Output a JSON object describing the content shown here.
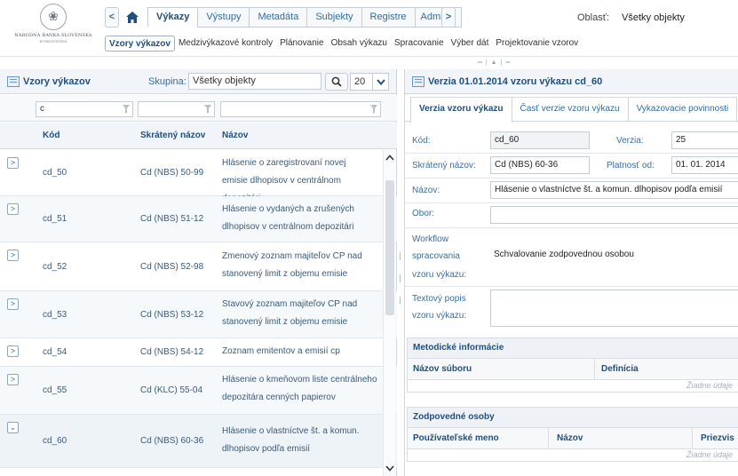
{
  "logo": {
    "line1": "NÁRODNÁ BANKA SLOVENSKA",
    "line2": "EUROSYSTÉM"
  },
  "header": {
    "tabs": [
      {
        "label": "Výkazy",
        "active": true
      },
      {
        "label": "Výstupy",
        "active": false
      },
      {
        "label": "Metadáta",
        "active": false
      },
      {
        "label": "Subjekty",
        "active": false
      },
      {
        "label": "Registre",
        "active": false
      },
      {
        "label": "Adminis",
        "active": false
      }
    ],
    "area_label": "Oblasť:",
    "area_value": "Všetky objekty"
  },
  "subnav": [
    {
      "label": "Vzory výkazov",
      "active": true
    },
    {
      "label": "Medzivýkazové kontroly",
      "active": false
    },
    {
      "label": "Plánovanie",
      "active": false
    },
    {
      "label": "Obsah výkazu",
      "active": false
    },
    {
      "label": "Spracovanie",
      "active": false
    },
    {
      "label": "Výber dát",
      "active": false
    },
    {
      "label": "Projektovanie vzorov",
      "active": false
    }
  ],
  "left": {
    "title": "Vzory výkazov",
    "group_label": "Skupina:",
    "group_value": "Všetky objekty",
    "page_size": "20",
    "filters": [
      "c",
      "",
      ""
    ],
    "columns": [
      "Kód",
      "Skrátený názov",
      "Názov"
    ],
    "rows": [
      {
        "code": "cd_50",
        "short": "Cd (NBS) 50-99",
        "name": "Hlásenie o zaregistrovaní novej emisie dlhopisov v centrálnom depozitári",
        "expanded": false
      },
      {
        "code": "cd_51",
        "short": "Cd (NBS) 51-12",
        "name": "Hlásenie o vydaných a zrušených dlhopisov v centrálnom depozitári",
        "expanded": false
      },
      {
        "code": "cd_52",
        "short": "Cd (NBS) 52-98",
        "name": "Zmenový zoznam majiteľov CP nad stanovený limit z objemu emisie",
        "expanded": false
      },
      {
        "code": "cd_53",
        "short": "Cd (NBS) 53-12",
        "name": "Stavový zoznam majiteľov CP nad stanovený limit z objemu emisie",
        "expanded": false
      },
      {
        "code": "cd_54",
        "short": "Cd (NBS) 54-12",
        "name": "Zoznam emitentov a emisií cp",
        "expanded": false
      },
      {
        "code": "cd_55",
        "short": "Cd (KLC) 55-04",
        "name": "Hlásenie o kmeňovom liste centrálneho depozitára cenných papierov",
        "expanded": false
      },
      {
        "code": "cd_60",
        "short": "Cd (NBS) 60-36",
        "name": "Hlásenie o vlastníctve št. a komun. dlhopisov podľa emisií",
        "expanded": true
      }
    ]
  },
  "right": {
    "title": "Verzia 01.01.2014 vzoru výkazu cd_60",
    "tabs": [
      {
        "label": "Verzia vzoru výkazu",
        "active": true
      },
      {
        "label": "Časť verzie vzoru výkazu",
        "active": false
      },
      {
        "label": "Vykazovacie povinnosti",
        "active": false
      }
    ],
    "form": {
      "code_label": "Kód:",
      "code_value": "cd_60",
      "version_label": "Verzia:",
      "version_value": "25",
      "short_label": "Skrátený názov:",
      "short_value": "Cd (NBS) 60-36",
      "valid_label": "Platnosť od:",
      "valid_value": "01. 01. 2014",
      "name_label": "Názov:",
      "name_value": "Hlásenie o vlastníctve št. a komun. dlhopisov podľa emisií",
      "field_label": "Obor:",
      "field_value": "",
      "workflow_label_1": "Workflow",
      "workflow_label_2": "spracovania",
      "workflow_label_3": "vzoru výkazu:",
      "workflow_value": "Schvalovanie zodpovednou osobou",
      "desc_label_1": "Textový popis",
      "desc_label_2": "vzoru výkazu:",
      "desc_value": ""
    },
    "methodic": {
      "title": "Metodické informácie",
      "columns": [
        "Názov súboru",
        "Definícia"
      ],
      "empty": "Žiadne údaje"
    },
    "responsible": {
      "title": "Zodpovedné osoby",
      "columns": [
        "Používateľské meno",
        "Názov",
        "Priezvis"
      ],
      "empty": "Žiadne údaje"
    }
  },
  "colors": {
    "accent": "#2f6ea5",
    "header_bg": "#f1f5f9",
    "border": "#cfd6dd"
  }
}
